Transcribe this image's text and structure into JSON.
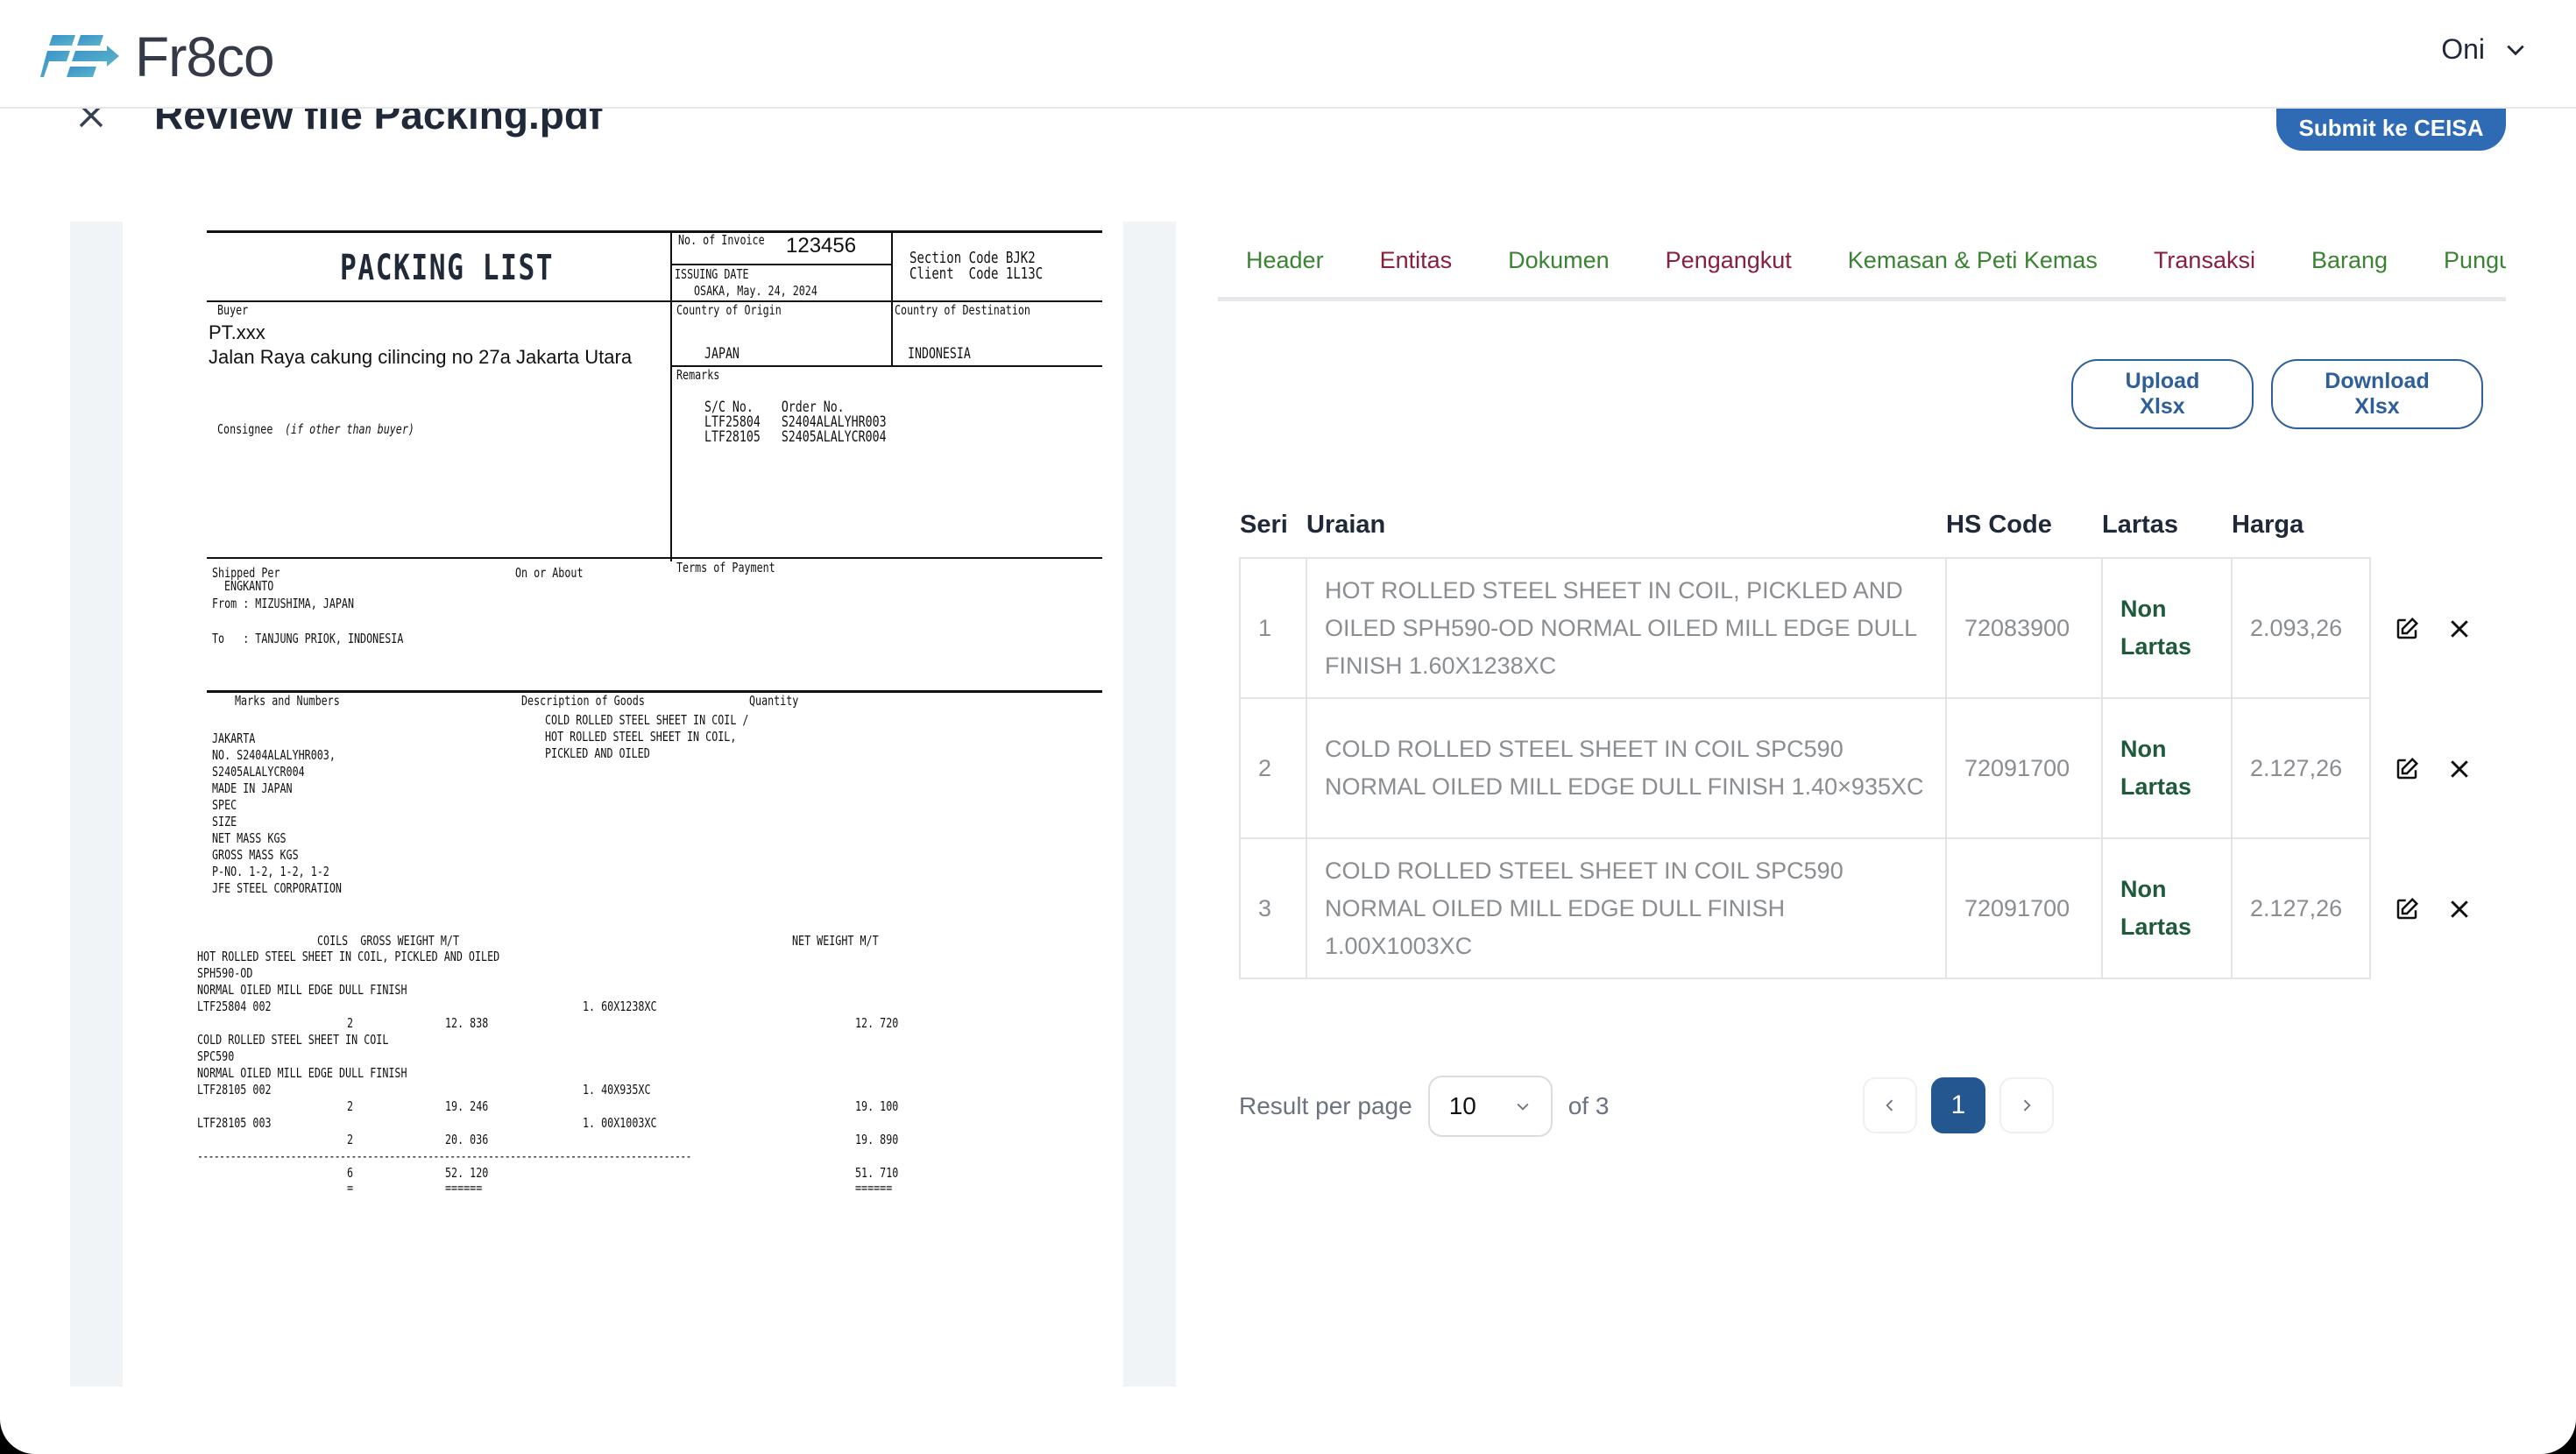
{
  "app": {
    "brand_name": "Fr8co",
    "user_name": "Oni",
    "colors": {
      "primary": "#2f6ab4",
      "tab_green": "#3a8332",
      "tab_maroon": "#8a1f3d",
      "lartas_text": "#1f5b3a",
      "pagination_active": "#245690"
    }
  },
  "page": {
    "title": "Review file Packing.pdf",
    "submit_label": "Submit ke CEISA"
  },
  "document": {
    "title": "PACKING LIST",
    "invoice_label": "No. of Invoice",
    "invoice_no": "123456",
    "issuing_date_label": "ISSUING DATE",
    "issuing_date": "OSAKA, May. 24, 2024",
    "section_code": "Section Code BJK2",
    "client_code": "Client  Code 1L13C",
    "buyer_label": "Buyer",
    "buyer_name": "PT.xxx",
    "buyer_address": "Jalan Raya cakung cilincing no 27a Jakarta Utara",
    "consignee_label": "Consignee",
    "consignee_note": "(if other than buyer)",
    "origin_label": "Country of Origin",
    "origin": "JAPAN",
    "destination_label": "Country of Destination",
    "destination": "INDONESIA",
    "remarks_label": "Remarks",
    "remarks": "S/C No.    Order No.\nLTF25804   S2404ALALYHR003\nLTF28105   S2405ALALYCR004",
    "shipped_per_label": "Shipped Per",
    "vessel": "ENGKANTO",
    "on_or_about_label": "On or About",
    "from": "From : MIZUSHIMA, JAPAN",
    "to": "To   : TANJUNG PRIOK, INDONESIA",
    "terms_label": "Terms of Payment",
    "marks_label": "Marks and Numbers",
    "description_label": "Description of Goods",
    "quantity_label": "Quantity",
    "marks": "JAKARTA\nNO. S2404ALALYHR003,\nS2405ALALYCR004\nMADE IN JAPAN\nSPEC\nSIZE\nNET MASS KGS\nGROSS MASS KGS\nP-NO. 1-2, 1-2, 1-2\nJFE STEEL CORPORATION",
    "description": "COLD ROLLED STEEL SHEET IN COIL /\nHOT ROLLED STEEL SHEET IN COIL,\nPICKLED AND OILED",
    "weights_header": "COILS  GROSS WEIGHT M/T",
    "net_header": "NET WEIGHT M/T",
    "goods_block": "HOT ROLLED STEEL SHEET IN COIL, PICKLED AND OILED\nSPH590-OD\nNORMAL OILED MILL EDGE DULL FINISH\nLTF25804 002",
    "goods_block2": "COLD ROLLED STEEL SHEET IN COIL\nSPC590\nNORMAL OILED MILL EDGE DULL FINISH\nLTF28105 002",
    "goods_block3": "LTF28105 003",
    "lines": [
      {
        "size": "1. 60X1238XC",
        "coils": "2",
        "gross": "12. 838",
        "net": "12. 720"
      },
      {
        "size": "1. 40X935XC",
        "coils": "2",
        "gross": "19. 246",
        "net": "19. 100"
      },
      {
        "size": "1. 00X1003XC",
        "coils": "2",
        "gross": "20. 036",
        "net": "19. 890"
      }
    ],
    "total": {
      "coils": "6",
      "gross": "52. 120",
      "net": "51. 710"
    },
    "dashes": "------------------------------------------------------------------------------------------",
    "eq_coils": "=",
    "eq_gross": "======",
    "eq_net": "======"
  },
  "tabs": [
    {
      "label": "Header",
      "color": "green"
    },
    {
      "label": "Entitas",
      "color": "maroon"
    },
    {
      "label": "Dokumen",
      "color": "green"
    },
    {
      "label": "Pengangkut",
      "color": "maroon"
    },
    {
      "label": "Kemasan & Peti Kemas",
      "color": "green"
    },
    {
      "label": "Transaksi",
      "color": "maroon"
    },
    {
      "label": "Barang",
      "color": "green",
      "active": true
    },
    {
      "label": "Pungutan",
      "color": "green"
    }
  ],
  "actions": {
    "upload_label": "Upload Xlsx",
    "download_label": "Download Xlsx"
  },
  "table": {
    "columns": [
      "Seri",
      "Uraian",
      "HS Code",
      "Lartas",
      "Harga"
    ],
    "rows": [
      {
        "seri": "1",
        "uraian": "HOT ROLLED STEEL SHEET IN COIL, PICKLED AND OILED SPH590-OD NORMAL OILED MILL EDGE DULL FINISH 1.60X1238XC",
        "hs_code": "72083900",
        "lartas": "Non Lartas",
        "harga": "2.093,26"
      },
      {
        "seri": "2",
        "uraian": "COLD ROLLED STEEL SHEET IN COIL SPC590 NORMAL OILED MILL EDGE DULL FINISH 1.40×935XC",
        "hs_code": "72091700",
        "lartas": "Non Lartas",
        "harga": "2.127,26"
      },
      {
        "seri": "3",
        "uraian": "COLD ROLLED STEEL SHEET IN COIL SPC590 NORMAL OILED MILL EDGE DULL FINISH 1.00X1003XC",
        "hs_code": "72091700",
        "lartas": "Non Lartas",
        "harga": "2.127,26"
      }
    ],
    "row_actions": [
      "edit-icon",
      "close-icon"
    ]
  },
  "pagination": {
    "label": "Result per page",
    "per_page": "10",
    "of_total": "of 3",
    "current_page": "1"
  }
}
